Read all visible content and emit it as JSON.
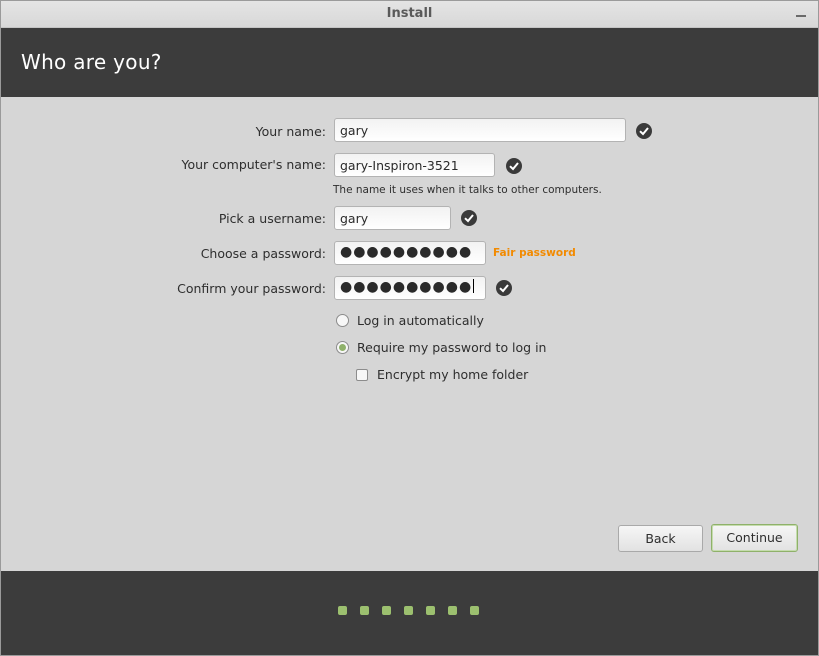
{
  "window": {
    "title": "Install"
  },
  "header": {
    "title": "Who are you?"
  },
  "form": {
    "name_label": "Your name:",
    "name_value": "gary",
    "computer_label": "Your computer's name:",
    "computer_value": "gary-Inspiron-3521",
    "computer_hint": "The name it uses when it talks to other computers.",
    "username_label": "Pick a username:",
    "username_value": "gary",
    "password_label": "Choose a password:",
    "password_value": "●●●●●●●●●●",
    "password_strength": "Fair password",
    "confirm_label": "Confirm your password:",
    "confirm_value": "●●●●●●●●●●",
    "login_auto_label": "Log in automatically",
    "login_auto_selected": false,
    "require_password_label": "Require my password to log in",
    "require_password_selected": true,
    "encrypt_label": "Encrypt my home folder",
    "encrypt_checked": false
  },
  "buttons": {
    "back": "Back",
    "continue": "Continue"
  },
  "progress": {
    "total_steps": 7
  },
  "colors": {
    "accent": "#8fb16a",
    "header_bg": "#3c3c3c",
    "strength_warning": "#f28a00"
  },
  "icons": {
    "valid": "check-circle-icon",
    "minimize": "minimize-icon"
  }
}
